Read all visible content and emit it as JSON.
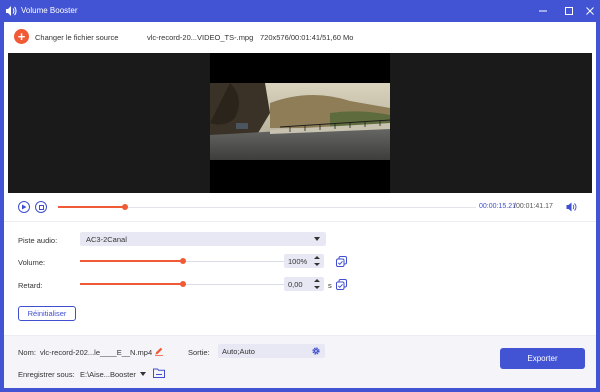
{
  "window": {
    "title": "Volume Booster",
    "accent_color": "#4254d4",
    "highlight_color": "#f15a36"
  },
  "file_bar": {
    "change_source_label": "Changer le fichier source",
    "file_name": "vlc-record-20...VIDEO_TS-.mpg",
    "file_info": "720x576/00:01:41/51,60 Mo"
  },
  "playback": {
    "current_time": "00:00:15.21",
    "total_time": "/00:01:41.17",
    "progress_fraction": 0.16
  },
  "settings": {
    "audio_track_label": "Piste audio:",
    "audio_track_value": "AC3-2Canal",
    "volume_label": "Volume:",
    "volume_value": "100%",
    "volume_fraction": 0.5,
    "delay_label": "Retard:",
    "delay_value": "0,00",
    "delay_unit": "s",
    "delay_fraction": 0.5,
    "reset_label": "Réinitialiser"
  },
  "footer": {
    "name_label": "Nom:",
    "name_value": "vlc-record-202...le____E__N.mp4",
    "output_label": "Sortie:",
    "output_value": "Auto;Auto",
    "save_label": "Enregistrer sous:",
    "save_path": "E:\\Aise...Booster",
    "export_label": "Exporter"
  }
}
